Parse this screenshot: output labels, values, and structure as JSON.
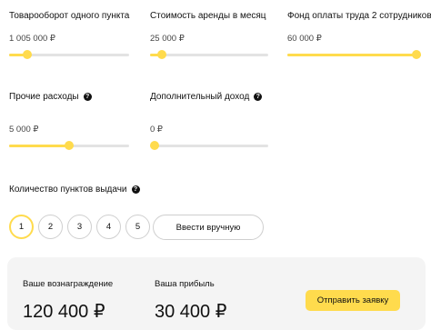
{
  "sliders": [
    {
      "label": "Товарооборот одного пункта",
      "value": "1 005 000 ₽",
      "level": 0.15,
      "help": false
    },
    {
      "label": "Стоимость аренды в месяц",
      "value": "25 000 ₽",
      "level": 0.1,
      "help": false
    },
    {
      "label": "Фонд оплаты труда 2 сотрудников",
      "value": "60 000 ₽",
      "level": 1.0,
      "help": false
    },
    {
      "label": "Прочие расходы",
      "value": "5 000 ₽",
      "level": 0.5,
      "help": true
    },
    {
      "label": "Дополнительный доход",
      "value": "0 ₽",
      "level": 0.0,
      "help": true
    }
  ],
  "help_icon": "question-icon",
  "help_glyph": "?",
  "points": {
    "label": "Количество пунктов выдачи",
    "options": [
      "1",
      "2",
      "3",
      "4",
      "5"
    ],
    "selected": "1",
    "manual_label": "Ввести вручную"
  },
  "result": {
    "reward_label": "Ваше вознаграждение",
    "reward_value": "120 400 ₽",
    "profit_label": "Ваша прибыль",
    "profit_value": "30 400 ₽",
    "submit_label": "Отправить заявку"
  },
  "colors": {
    "accent": "#ffdb4d",
    "track": "#e3e3e3",
    "panel": "#f4f4f4"
  }
}
